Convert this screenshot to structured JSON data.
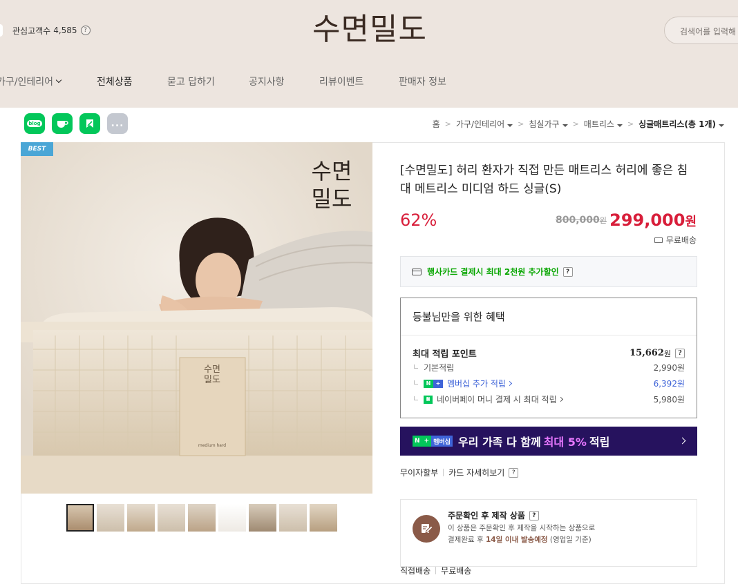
{
  "header": {
    "interest_label": "관심고객수",
    "interest_count": "4,585",
    "help": "?",
    "brand": "수면밀도",
    "search_placeholder": "검색어를 입력해"
  },
  "nav": [
    "가구/인테리어",
    "전체상품",
    "묻고 답하기",
    "공지사항",
    "리뷰이벤트",
    "판매자 정보"
  ],
  "share": {
    "blog": "blog",
    "cafe": "cafe",
    "more": "..."
  },
  "breadcrumb": [
    "홈",
    "가구/인테리어",
    "침실가구",
    "매트리스",
    "싱글매트리스(총 1개)"
  ],
  "image": {
    "badge": "BEST",
    "brand_overlay_line1": "수면",
    "brand_overlay_line2": "밀도",
    "tag_brand": "수면\n밀도",
    "tag_caption": "medium hard",
    "thumbnail_count": 9
  },
  "product": {
    "title": "[수면밀도] 허리 환자가 직접 만든 매트리스 허리에 좋은 침대 메트리스 미디엄 하드 싱글(S)",
    "discount": "62%",
    "original_price": "800,000",
    "original_unit": "원",
    "sale_price": "299,000",
    "sale_unit": "원",
    "delivery": "무료배송"
  },
  "card_promo": {
    "text": "행사카드 결제시 최대 2천원 추가할인",
    "help": "?"
  },
  "benefit": {
    "title": "등불님만을 위한 혜택",
    "max_label": "최대 적립 포인트",
    "max_value": "15,662",
    "max_unit": "원",
    "help": "?",
    "rows": [
      {
        "label": "기본적립",
        "value": "2,990원"
      },
      {
        "label": "멤버십 추가 적립",
        "value": "6,392원"
      },
      {
        "label": "네이버페이 머니 결제 시 최대 적립",
        "value": "5,980원"
      }
    ]
  },
  "membership": {
    "badge_n": "N",
    "badge_plus": "+",
    "badge_text": "멤버십",
    "text_pre": "우리 가족 다 함께",
    "text_accent": "최대 5%",
    "text_post": "적립"
  },
  "installment": {
    "a": "무이자할부",
    "b": "카드 자세히보기",
    "help": "?"
  },
  "made_order": {
    "title": "주문확인 후 제작 상품",
    "help": "?",
    "desc1": "이 상품은 주문확인 후 제작을 시작하는 상품으로",
    "desc2_pre": "결제완료 후",
    "desc2_bold": "14일 이내 발송예정",
    "desc2_post": "(영업일 기준)"
  },
  "bottom": {
    "a": "직접배송",
    "b": "무료배송"
  },
  "colors": {
    "header_bg": "#ede5df",
    "sale_red": "#d81e3a",
    "naver_green": "#08a600",
    "membership_bg": "#26125e",
    "accent_purple": "#e878ff",
    "link_blue": "#3f64d8"
  }
}
